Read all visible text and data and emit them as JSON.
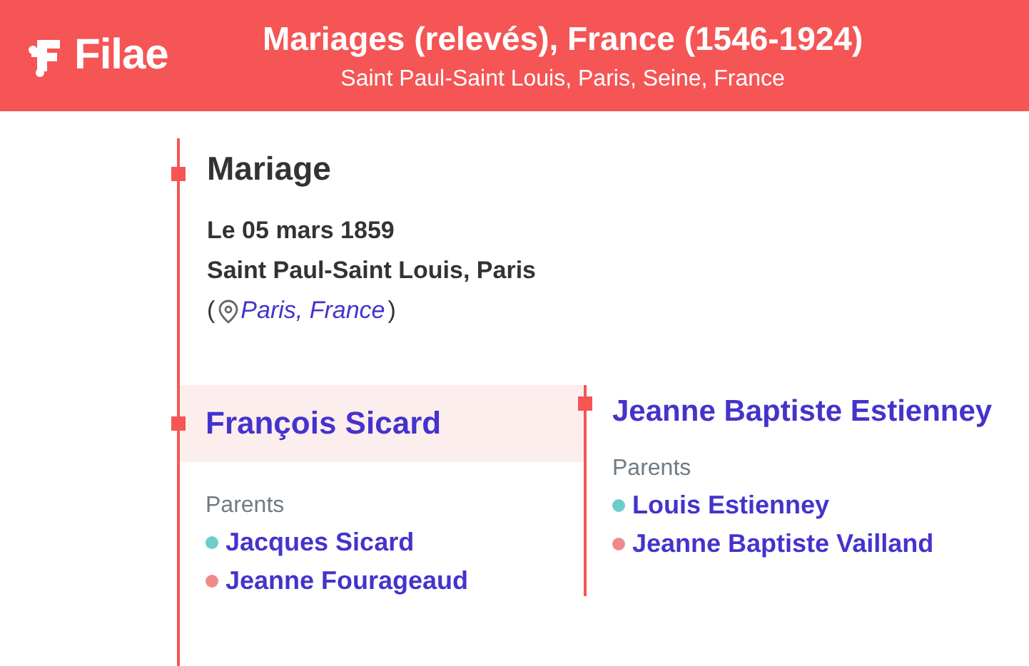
{
  "header": {
    "logo": "Filae",
    "title": "Mariages (relevés), France (1546-1924)",
    "subtitle": "Saint Paul-Saint Louis, Paris, Seine, France"
  },
  "event": {
    "title": "Mariage",
    "date": "Le 05 mars 1859",
    "place": "Saint Paul-Saint Louis, Paris",
    "open_paren": "(",
    "location_link": "Paris, France",
    "close_paren": ")"
  },
  "spouses": [
    {
      "name": "François Sicard",
      "highlighted": true,
      "parents_label": "Parents",
      "parents": [
        {
          "name": "Jacques Sicard",
          "color": "#6ccdcb"
        },
        {
          "name": "Jeanne Fourageaud",
          "color": "#f08a8a"
        }
      ]
    },
    {
      "name": "Jeanne Baptiste Estienney",
      "highlighted": false,
      "parents_label": "Parents",
      "parents": [
        {
          "name": "Louis Estienney",
          "color": "#6ccdcb"
        },
        {
          "name": "Jeanne Baptiste Vailland",
          "color": "#f08a8a"
        }
      ]
    }
  ]
}
